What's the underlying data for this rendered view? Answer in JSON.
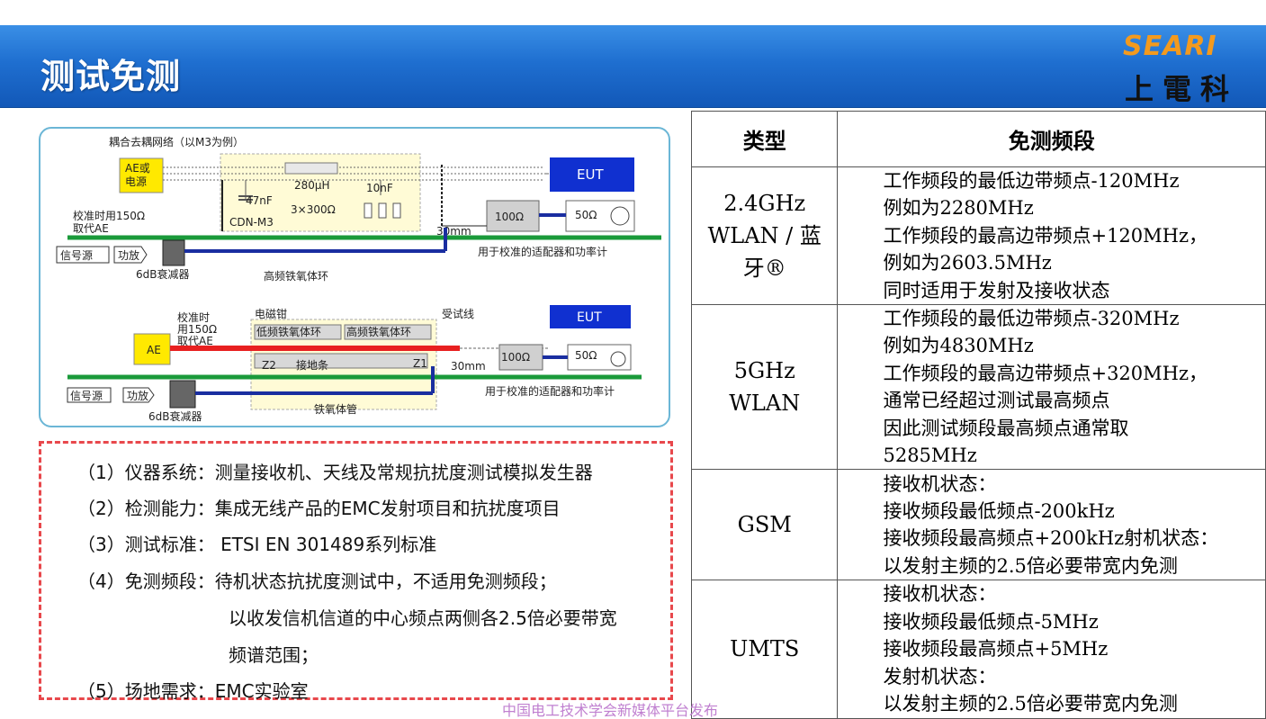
{
  "header": {
    "title": "测试免测",
    "logo_en": "SEARI",
    "logo_cn": "上電科"
  },
  "diagram": {
    "top": {
      "title": "耦合去耦网络（以M3为例）",
      "ae_source": "AE或\n电源",
      "cap1": "47nF",
      "inductor": "280μH",
      "cap2": "10nF",
      "resistor": "3×300Ω",
      "cdn": "CDN-M3",
      "calib": "校准时用150Ω",
      "calib2": "取代AE",
      "eut": "EUT",
      "r100": "100Ω",
      "r50": "50Ω",
      "dist": "30mm",
      "signal": "信号源",
      "amp": "功放",
      "atten": "6dB衰减器",
      "ferrite": "高频铁氧体环",
      "adapter": "用于校准的适配器和功率计"
    },
    "bottom": {
      "clamp": "电磁钳",
      "calib": "校准时",
      "calib2": "用150Ω",
      "calib3": "取代AE",
      "ae": "AE",
      "low_ferrite": "低频铁氧体环",
      "high_ferrite": "高频铁氧体环",
      "test_line": "受试线",
      "eut": "EUT",
      "z2": "Z2",
      "ground": "接地条",
      "z1": "Z1",
      "dist": "30mm",
      "r100": "100Ω",
      "r50": "50Ω",
      "signal": "信号源",
      "amp": "功放",
      "atten": "6dB衰减器",
      "ferrite_tube": "铁氧体管",
      "adapter": "用于校准的适配器和功率计"
    }
  },
  "description": [
    "（1）仪器系统：测量接收机、天线及常规抗扰度测试模拟发生器",
    "（2）检测能力：集成无线产品的EMC发射项目和抗扰度项目",
    "（3）测试标准： ETSI EN 301489系列标准",
    "（4）免测频段：待机状态抗扰度测试中，不适用免测频段；",
    "以收发信机信道的中心频点两侧各2.5倍必要带宽",
    "频谱范围；",
    "（5）场地需求：EMC实验室"
  ],
  "table": {
    "headers": [
      "类型",
      "免测频段"
    ],
    "rows": [
      {
        "type": [
          "2.4GHz",
          "WLAN / 蓝",
          "牙®"
        ],
        "band": [
          "工作频段的最低边带频点-120MHz",
          "例如为2280MHz",
          "工作频段的最高边带频点+120MHz，",
          "例如为2603.5MHz",
          "同时适用于发射及接收状态"
        ]
      },
      {
        "type": [
          "5GHz",
          "WLAN"
        ],
        "band": [
          "工作频段的最低边带频点-320MHz",
          "例如为4830MHz",
          "工作频段的最高边带频点+320MHz，",
          "通常已经超过测试最高频点",
          "因此测试频段最高频点通常取",
          "5285MHz"
        ]
      },
      {
        "type": [
          "GSM"
        ],
        "band": [
          "接收机状态：",
          "接收频段最低频点-200kHz",
          "接收频段最高频点+200kHz射机状态：",
          "以发射主频的2.5倍必要带宽内免测"
        ]
      },
      {
        "type": [
          "UMTS"
        ],
        "band": [
          "接收机状态：",
          "接收频段最低频点-5MHz",
          "接收频段最高频点+5MHz",
          "发射机状态：",
          "以发射主频的2.5倍必要带宽内免测"
        ]
      }
    ]
  },
  "footer": "中国电工技术学会新媒体平台发布",
  "colors": {
    "header_blue": "#1f6fd0",
    "logo_orange": "#f39a1e",
    "dash_red": "#e8484c",
    "eut_blue": "#1030d0",
    "cable_green": "#1a9a3a",
    "cable_blue": "#1a2ea0",
    "clamp_red": "#e82020",
    "footer_purple": "#c080d0"
  }
}
